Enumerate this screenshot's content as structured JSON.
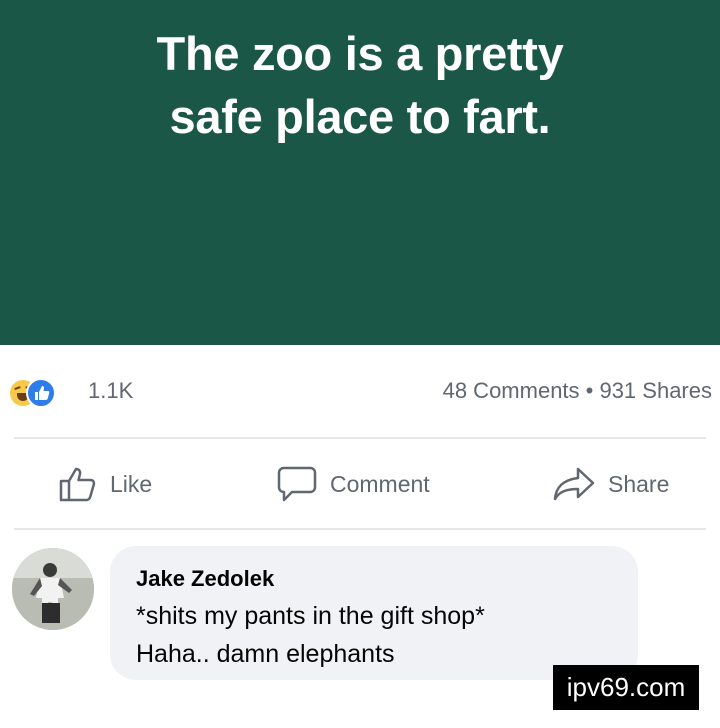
{
  "post": {
    "text_lines": [
      "The zoo is a pretty",
      "safe place to fart."
    ],
    "background_color": "#1b5747"
  },
  "reactions": {
    "icons": [
      "haha-icon",
      "like-icon"
    ],
    "count": "1.1K",
    "comments_shares": "48 Comments • 931 Shares"
  },
  "actions": {
    "like_label": "Like",
    "comment_label": "Comment",
    "share_label": "Share"
  },
  "comment": {
    "author": "Jake Zedolek",
    "lines": [
      "*shits my pants in the gift shop*",
      "Haha.. damn elephants"
    ]
  },
  "watermark": "ipv69.com"
}
